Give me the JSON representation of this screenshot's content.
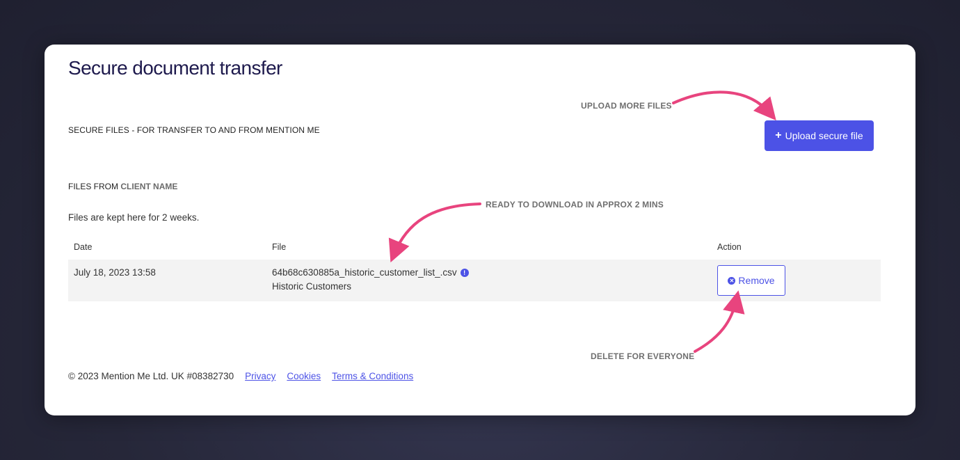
{
  "page": {
    "title": "Secure document transfer",
    "section_title": "SECURE FILES - FOR TRANSFER TO AND FROM MENTION ME",
    "upload_button": "Upload secure file",
    "files_from_prefix": "FILES FROM",
    "files_from_client": "CLIENT NAME",
    "retention_note": "Files are kept here for 2 weeks."
  },
  "table": {
    "headers": {
      "date": "Date",
      "file": "File",
      "action": "Action"
    },
    "rows": [
      {
        "date": "July 18, 2023 13:58",
        "filename": "64b68c630885a_historic_customer_list_.csv",
        "description": "Historic Customers",
        "action_label": "Remove"
      }
    ]
  },
  "footer": {
    "copyright": "© 2023 Mention Me Ltd. UK #08382730",
    "links": [
      "Privacy",
      "Cookies",
      "Terms & Conditions"
    ]
  },
  "annotations": {
    "upload": "UPLOAD MORE FILES",
    "ready": "READY TO DOWNLOAD IN APPROX 2 MINS",
    "delete": "DELETE FOR EVERYONE"
  },
  "icons": {
    "upload": "plus-icon",
    "file_info": "info-icon",
    "remove": "close-circle-icon"
  },
  "colors": {
    "accent": "#4c52e6",
    "annotation_arrow": "#e8447e",
    "title": "#1e1a4d",
    "background": "#262739"
  }
}
